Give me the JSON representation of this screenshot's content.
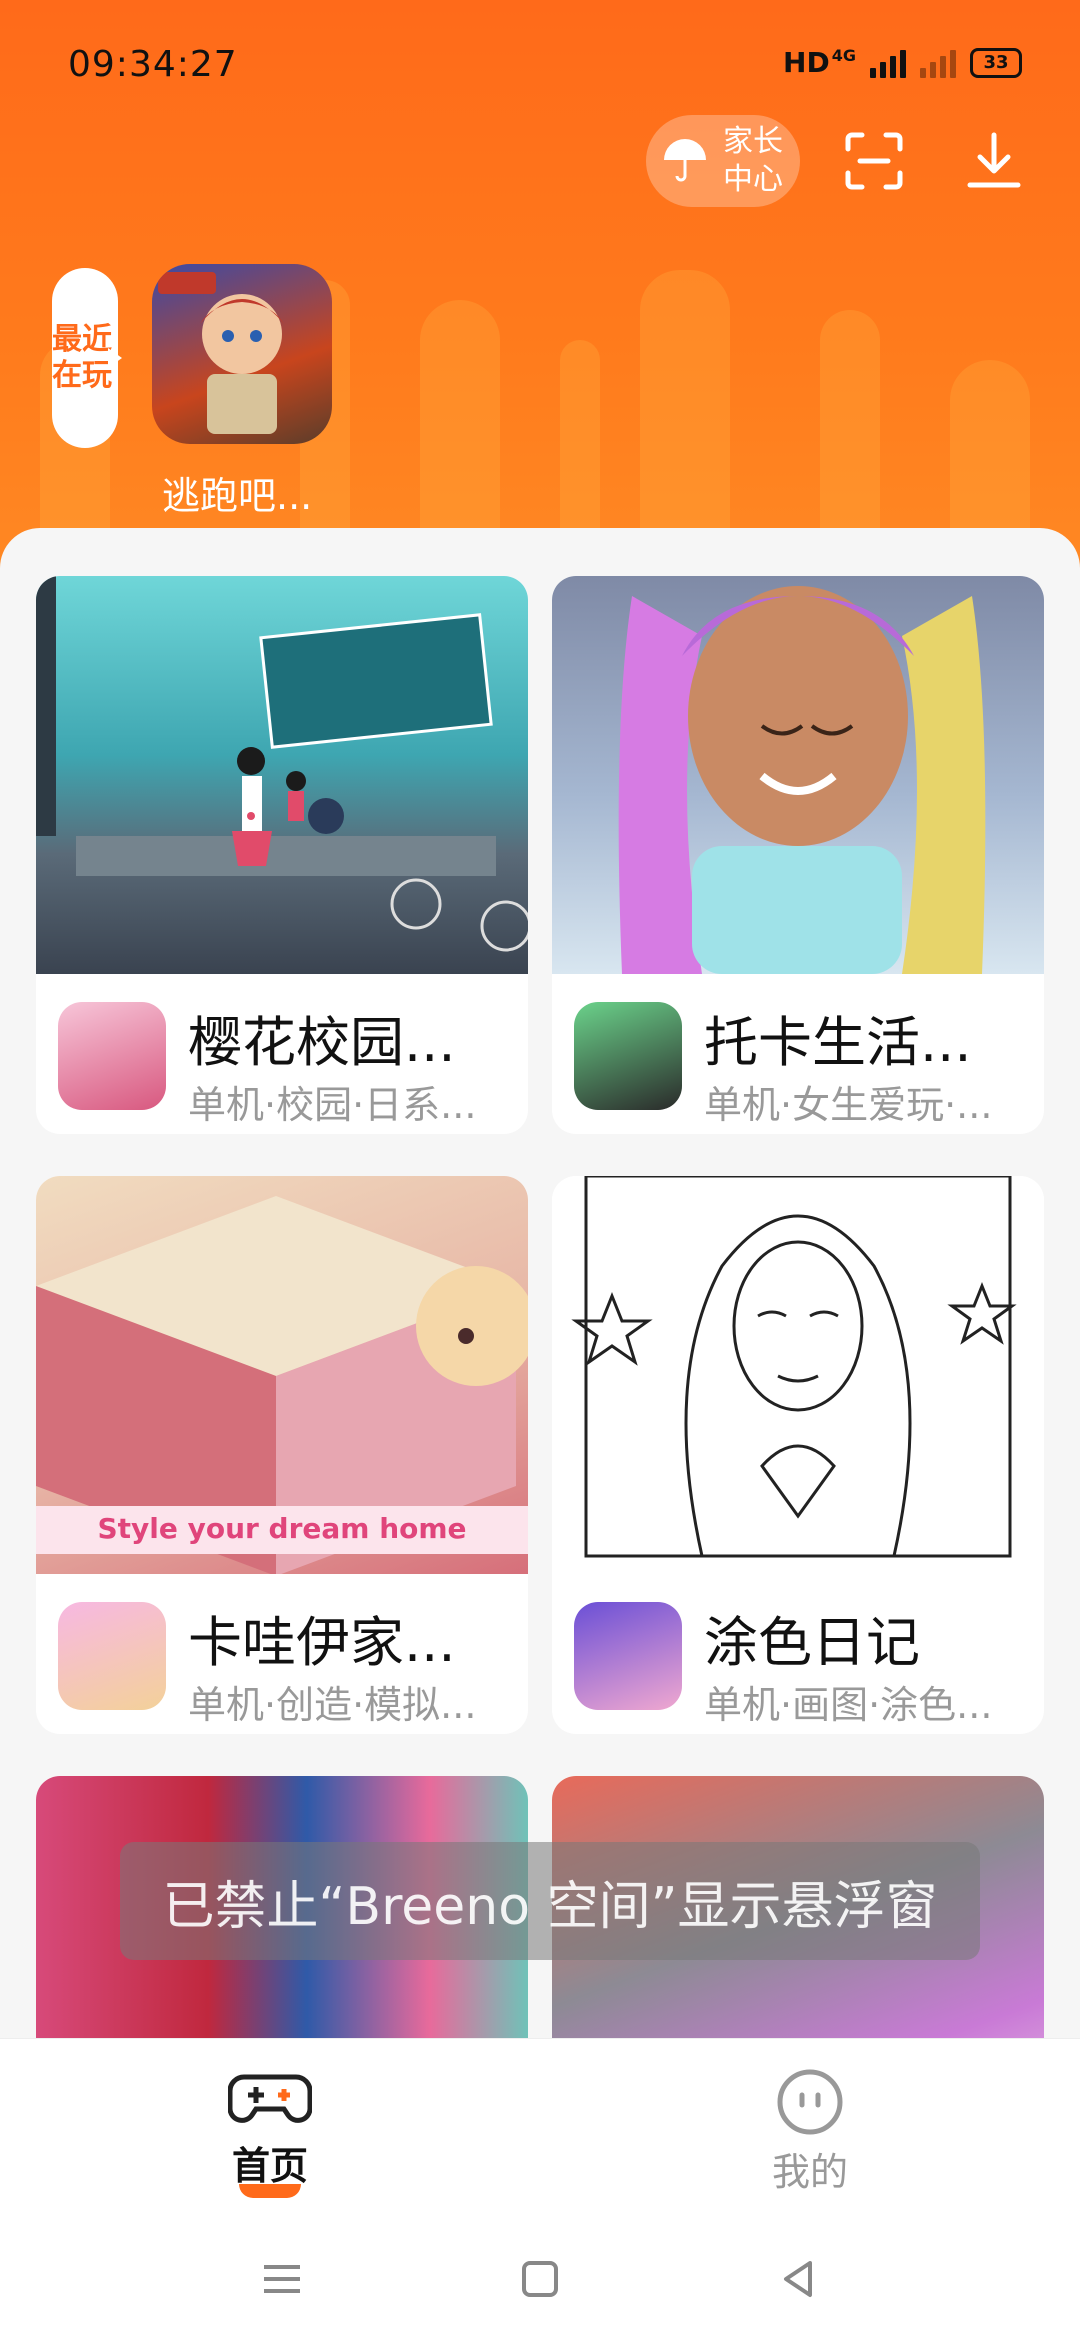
{
  "status_bar": {
    "time": "09:34:27",
    "network_label": "HD",
    "network_type": "4G",
    "battery": "33"
  },
  "header": {
    "parent_center_label": "家长中心",
    "recent_tag": "最近在玩",
    "recent_game": "逃跑吧..."
  },
  "games": [
    {
      "title": "樱花校园...",
      "tags": "单机·校园·日系..."
    },
    {
      "title": "托卡生活...",
      "tags": "单机·女生爱玩·..."
    },
    {
      "title": "卡哇伊家...",
      "tags": "单机·创造·模拟..."
    },
    {
      "title": "涂色日记",
      "tags": "单机·画图·涂色..."
    }
  ],
  "toast": "已禁止“Breeno 空间”显示悬浮窗",
  "nav": {
    "home": "首页",
    "mine": "我的"
  },
  "colors": {
    "brand": "#ff6a1a",
    "text_primary": "#111111",
    "text_secondary": "#999999"
  },
  "icons": [
    "umbrella-icon",
    "scan-icon",
    "download-icon",
    "gamepad-icon",
    "smiley-icon",
    "menu-icon",
    "home-square-icon",
    "back-triangle-icon"
  ]
}
